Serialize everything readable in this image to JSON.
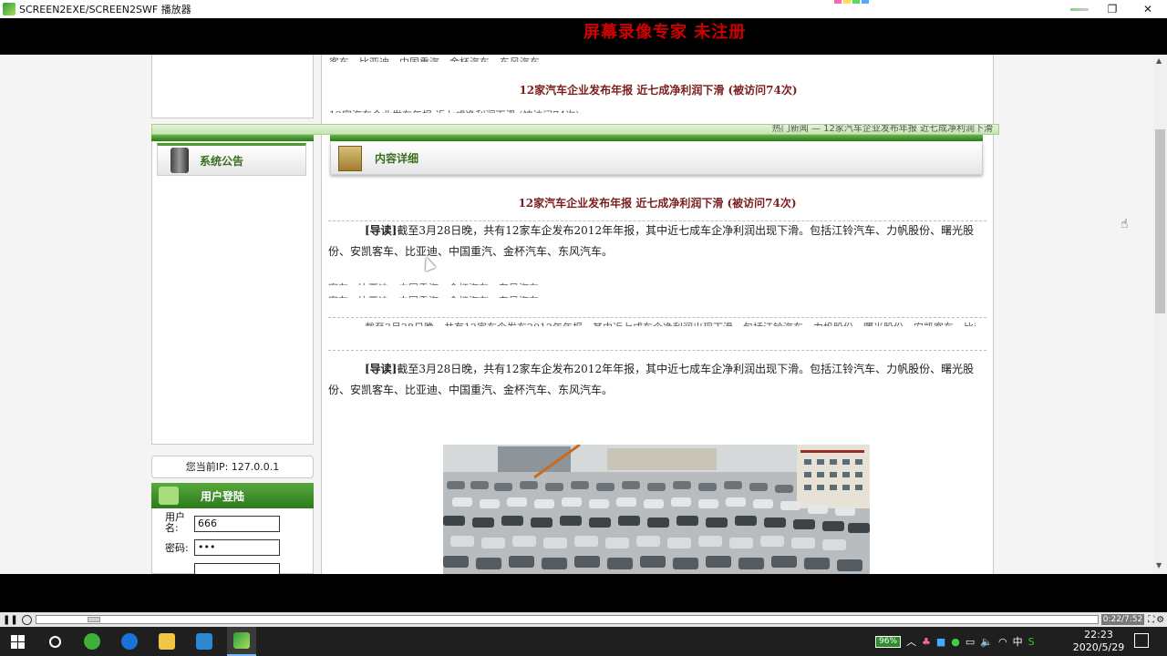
{
  "window": {
    "title": "SCREEN2EXE/SCREEN2SWF 播放器",
    "watermark": "屏幕录像专家 未注册"
  },
  "sidebar": {
    "announcement_title": "系统公告",
    "ip_text": "您当前IP: 127.0.0.1",
    "login_title": "用户登陆",
    "username_label": "用户名:",
    "username_value": "666",
    "password_label": "密码:",
    "password_value": "•••"
  },
  "content": {
    "section_title": "内容详细",
    "article_title": "12家汽车企业发布年报 近七成净利润下滑 (被访问74次)",
    "lead_label": "[导读]",
    "lead_text": "截至3月28日晚，共有12家车企发布2012年年报，其中近七成车企净利润出现下滑。包括江铃汽车、力帆股份、曙光股份、安凯客车、比亚迪、中国重汽、金杯汽车、东风汽车。",
    "ghost_line_top": "客车、比亚迪、中国重汽、金杯汽车、东风汽车。",
    "ghost_marquee": "热门新闻 — 12家汽车企业发布年报 近七成净利润下滑"
  },
  "player": {
    "time": "0:22/7:52"
  },
  "taskbar": {
    "battery": "96%",
    "time": "22:23",
    "date": "2020/5/29"
  },
  "colors": {
    "brand_green": "#3e9a2c",
    "title_red": "#7a1e1e",
    "watermark_red": "#d00000"
  }
}
